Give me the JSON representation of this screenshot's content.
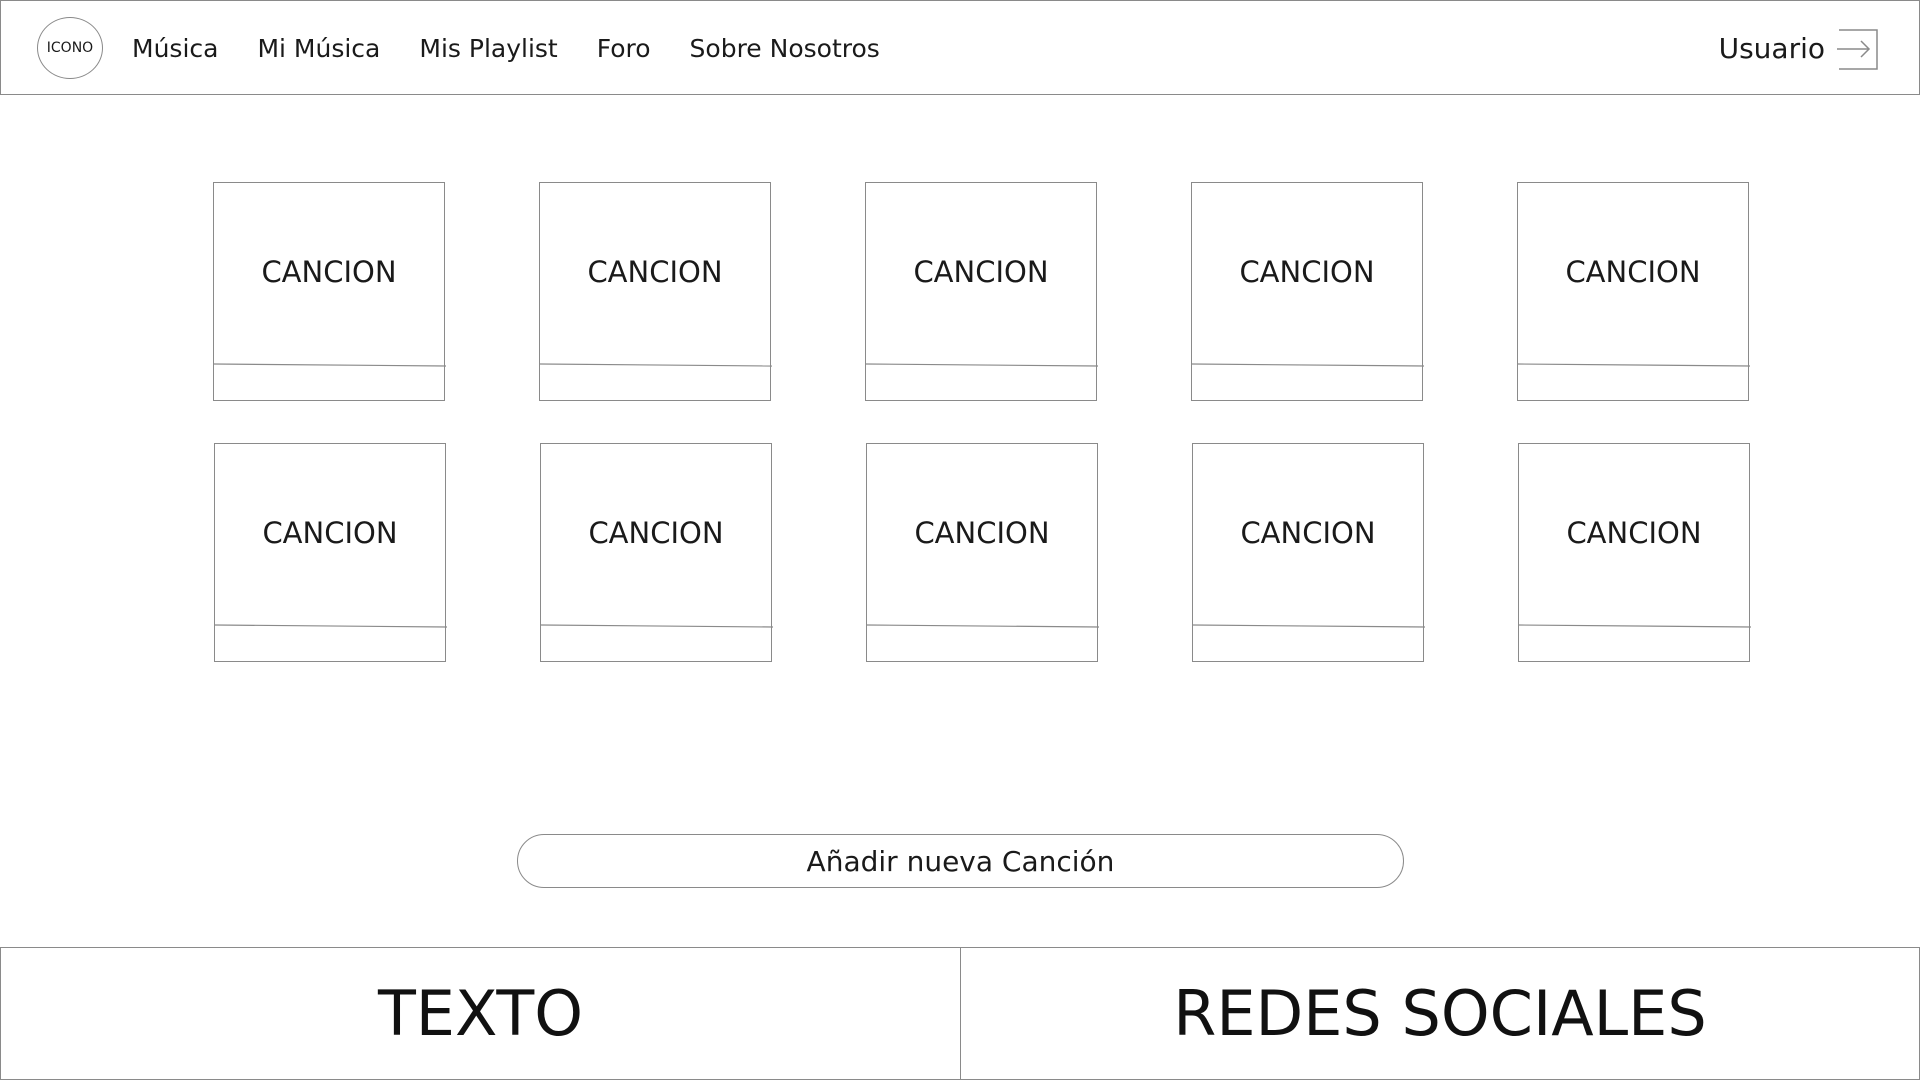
{
  "header": {
    "logo_text": "ICONO",
    "nav": [
      {
        "label": "Música"
      },
      {
        "label": "Mi Música"
      },
      {
        "label": "Mis Playlist"
      },
      {
        "label": "Foro"
      },
      {
        "label": "Sobre Nosotros"
      }
    ],
    "user_label": "Usuario",
    "logout_icon": "logout-arrow-icon"
  },
  "songs": [
    {
      "title": "CANCION"
    },
    {
      "title": "CANCION"
    },
    {
      "title": "CANCION"
    },
    {
      "title": "CANCION"
    },
    {
      "title": "CANCION"
    },
    {
      "title": "CANCION"
    },
    {
      "title": "CANCION"
    },
    {
      "title": "CANCION"
    },
    {
      "title": "CANCION"
    },
    {
      "title": "CANCION"
    }
  ],
  "add_button_label": "Añadir nueva Canción",
  "footer": {
    "left_text": "TEXTO",
    "right_text": "REDES SOCIALES"
  },
  "colors": {
    "border": "#8a8a8a",
    "text": "#1a1a1a",
    "background": "#ffffff"
  }
}
